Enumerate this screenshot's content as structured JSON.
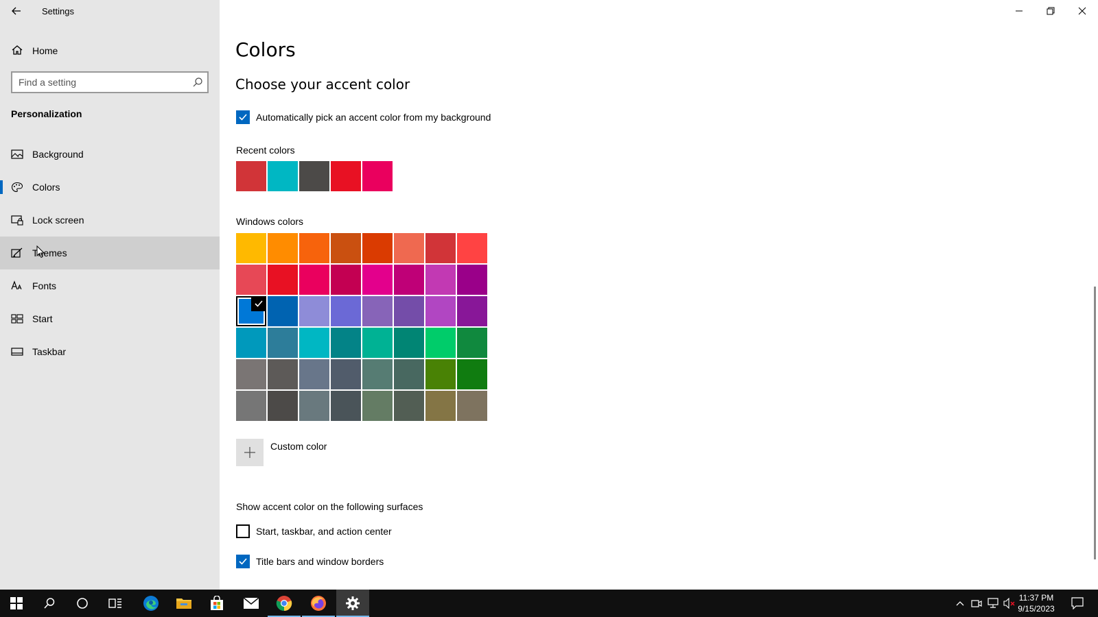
{
  "app": {
    "title": "Settings"
  },
  "sidebar": {
    "home_label": "Home",
    "search_placeholder": "Find a setting",
    "section_title": "Personalization",
    "items": [
      {
        "label": "Background",
        "icon": "image-icon"
      },
      {
        "label": "Colors",
        "icon": "palette-icon",
        "selected": true
      },
      {
        "label": "Lock screen",
        "icon": "lock-screen-icon"
      },
      {
        "label": "Themes",
        "icon": "brush-icon",
        "hovered": true
      },
      {
        "label": "Fonts",
        "icon": "font-icon"
      },
      {
        "label": "Start",
        "icon": "start-menu-icon"
      },
      {
        "label": "Taskbar",
        "icon": "taskbar-icon"
      }
    ]
  },
  "main": {
    "page_title": "Colors",
    "heading": "Choose your accent color",
    "auto_pick_label": "Automatically pick an accent color from my background",
    "auto_pick_checked": true,
    "recent_label": "Recent colors",
    "recent_colors": [
      "#d13438",
      "#00b7c3",
      "#4c4a48",
      "#e81123",
      "#ea005e"
    ],
    "windows_label": "Windows colors",
    "windows_colors": [
      "#ffb900",
      "#ff8c00",
      "#f7630c",
      "#ca5010",
      "#da3b01",
      "#ef6950",
      "#d13438",
      "#ff4343",
      "#e74856",
      "#e81123",
      "#ea005e",
      "#c30052",
      "#e3008c",
      "#bf0077",
      "#c239b3",
      "#9a0089",
      "#0078d7",
      "#0063b1",
      "#8e8cd8",
      "#6b69d6",
      "#8764b8",
      "#744da9",
      "#b146c2",
      "#881798",
      "#0099bc",
      "#2d7d9a",
      "#00b7c3",
      "#038387",
      "#00b294",
      "#018574",
      "#00cc6a",
      "#10893e",
      "#7a7574",
      "#5d5a58",
      "#68768a",
      "#515c6b",
      "#567c73",
      "#486860",
      "#498205",
      "#107c10",
      "#767676",
      "#4c4a48",
      "#69797e",
      "#4a5459",
      "#647c64",
      "#525e54",
      "#847545",
      "#7e735f"
    ],
    "selected_color_index": 16,
    "custom_color_label": "Custom color",
    "surfaces_label": "Show accent color on the following surfaces",
    "surface_start_label": "Start, taskbar, and action center",
    "surface_start_checked": false,
    "surface_title_label": "Title bars and window borders",
    "surface_title_checked": true
  },
  "taskbar": {
    "time": "11:37 PM",
    "date": "9/15/2023"
  },
  "colors": {
    "accent": "#0067c0",
    "sidebar_bg": "#e6e6e6",
    "taskbar_bg": "#101010"
  }
}
